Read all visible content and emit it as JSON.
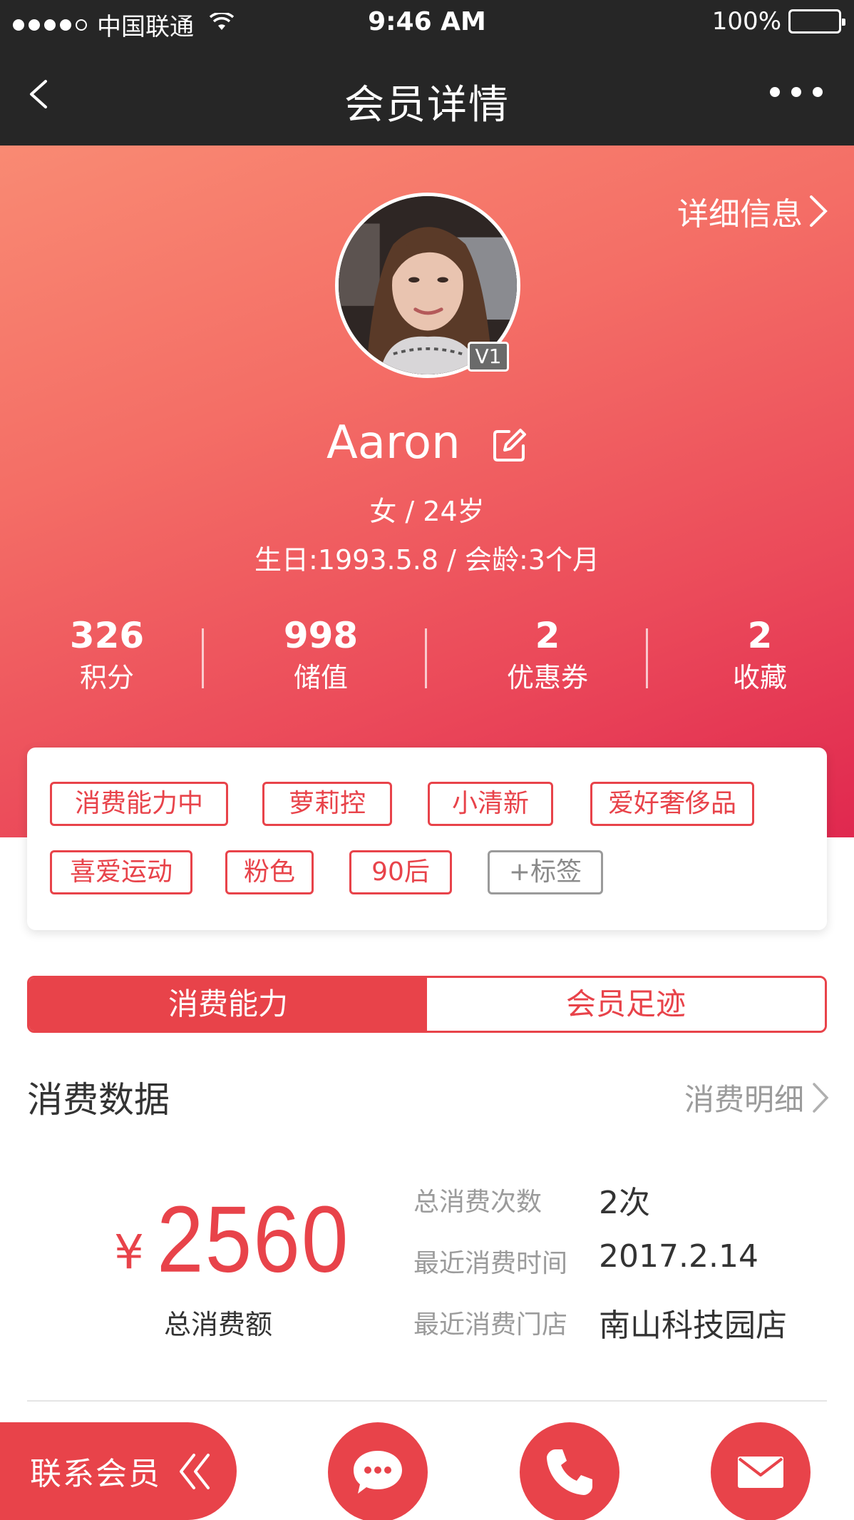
{
  "status_bar": {
    "carrier": "中国联通",
    "time": "9:46 AM",
    "battery": "100%"
  },
  "nav": {
    "title": "会员详情"
  },
  "profile": {
    "detail_link": "详细信息",
    "level": "V1",
    "name": "Aaron",
    "gender_age": "女 / 24岁",
    "birthday_tenure": "生日:1993.5.8 / 会龄:3个月"
  },
  "stats": [
    {
      "value": "326",
      "label": "积分"
    },
    {
      "value": "998",
      "label": "储值"
    },
    {
      "value": "2",
      "label": "优惠券"
    },
    {
      "value": "2",
      "label": "收藏"
    }
  ],
  "tags": [
    "消费能力中",
    "萝莉控",
    "小清新",
    "爱好奢侈品",
    "喜爱运动",
    "粉色",
    "90后"
  ],
  "add_tag": "+标签",
  "tabs": {
    "active": "消费能力",
    "inactive": "会员足迹"
  },
  "consumption": {
    "title": "消费数据",
    "detail_link": "消费明细",
    "currency": "¥",
    "total": "2560",
    "total_label": "总消费额",
    "rows": [
      {
        "label": "总消费次数",
        "value": "2次"
      },
      {
        "label": "最近消费时间",
        "value": "2017.2.14"
      },
      {
        "label": "最近消费门店",
        "value": "南山科技园店"
      }
    ]
  },
  "bottom_bar": {
    "contact_label": "联系会员",
    "accent_color": "#e8434a"
  },
  "icons": [
    "back-icon",
    "more-icon",
    "chevron-right-icon",
    "edit-icon",
    "double-chevron-left-icon",
    "chat-icon",
    "phone-icon",
    "mail-icon"
  ]
}
